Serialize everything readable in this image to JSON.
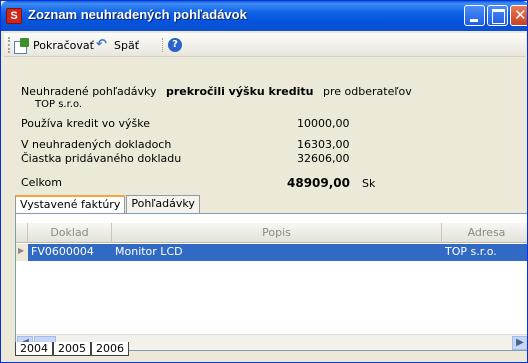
{
  "window": {
    "title": "Zoznam neuhradených pohľadávok",
    "app_icon": "S"
  },
  "toolbar": {
    "continue_label": "Pokračovať",
    "back_label": "Späť",
    "help_icon": "help-icon"
  },
  "info": {
    "line1_prefix": "Neuhradené pohľadávky",
    "line1_bold": "prekročili výšku kreditu",
    "line1_suffix": "pre odberateľov",
    "customer": "TOP s.r.o.",
    "credit_label": "Používa kredit vo výške",
    "credit_value": "10000,00",
    "unpaid_label": "V neuhradených dokladoch",
    "unpaid_value": "16303,00",
    "added_label": "Čiastka pridávaného dokladu",
    "added_value": "32606,00",
    "total_label": "Celkom",
    "total_value": "48909,00",
    "currency": "Sk"
  },
  "top_tabs": [
    {
      "label": "Vystavené faktúry",
      "active": true
    },
    {
      "label": "Pohľadávky",
      "active": false
    }
  ],
  "grid": {
    "columns": [
      "Doklad",
      "Popis",
      "Adresa"
    ],
    "rows": [
      {
        "doklad": "FV0600004",
        "popis": "Monitor LCD",
        "adresa": "TOP s.r.o."
      }
    ]
  },
  "bottom_tabs": [
    {
      "label": "2004",
      "active": false
    },
    {
      "label": "2005",
      "active": false
    },
    {
      "label": "2006",
      "active": true
    }
  ],
  "colors": {
    "titlebar": "#0553dc",
    "selection": "#316ac5",
    "window_bg": "#ece9d8"
  }
}
